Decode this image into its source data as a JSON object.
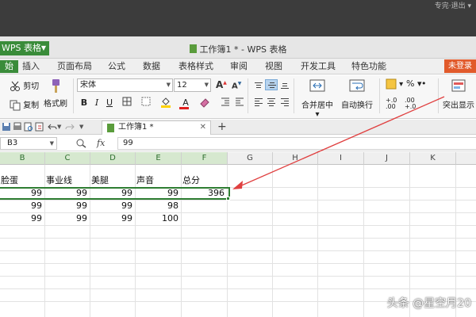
{
  "top_strip": {
    "corner_text": "专完·退出 ▾"
  },
  "app": {
    "menu_label": "WPS 表格",
    "window_title": "工作簿1 * - WPS 表格"
  },
  "menu": {
    "tabs": [
      "始",
      "插入",
      "页面布局",
      "公式",
      "数据",
      "表格样式",
      "审阅",
      "视图",
      "开发工具",
      "特色功能"
    ],
    "login": "未登录"
  },
  "ribbon": {
    "cut": "剪切",
    "copy": "复制",
    "format_painter": "格式刷",
    "font_name": "宋体",
    "font_size": "12",
    "bold": "B",
    "italic": "I",
    "underline": "U",
    "font_color_letter": "A",
    "grow_font": "A",
    "shrink_font": "A",
    "merge_center": "合并居中",
    "wrap_text": "自动换行",
    "percent": "%",
    "comma": "•",
    "inc_decimal": "+.0 .00",
    "dec_decimal": ".00 +.0",
    "highlight": "突出显示"
  },
  "quick_access": {
    "doc_tab": "工作簿1 *",
    "new_tab": "+"
  },
  "formula_bar": {
    "cell_ref": "B3",
    "fx": "fx",
    "value": "99"
  },
  "grid": {
    "columns": [
      "B",
      "C",
      "D",
      "E",
      "F",
      "G",
      "H",
      "I",
      "J",
      "K"
    ],
    "headers": [
      "脸蛋",
      "事业线",
      "美腿",
      "声音",
      "总分"
    ],
    "rows": [
      [
        "99",
        "99",
        "99",
        "99",
        "396"
      ],
      [
        "99",
        "99",
        "99",
        "98",
        ""
      ],
      [
        "99",
        "99",
        "99",
        "100",
        ""
      ]
    ]
  },
  "watermark": "头条 @星空月20",
  "colors": {
    "accent_green": "#3a8c3a",
    "login_orange": "#e15a2b",
    "arrow_red": "#e04040"
  }
}
